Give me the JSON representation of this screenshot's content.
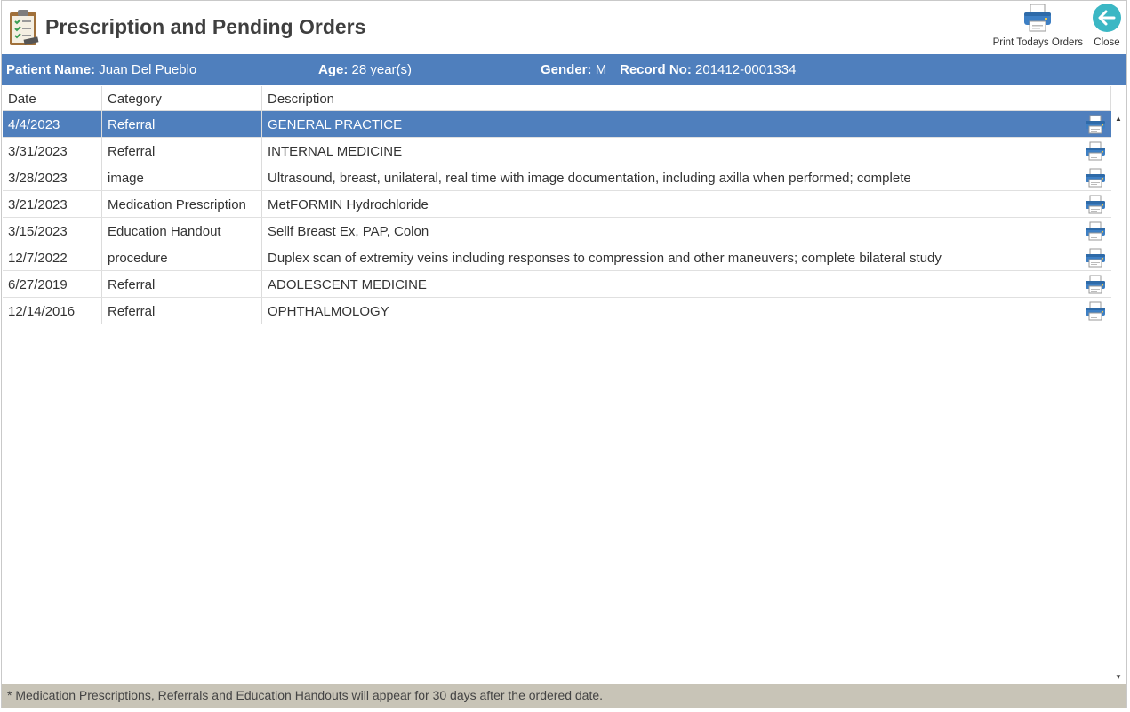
{
  "header": {
    "title": "Prescription and Pending Orders",
    "print_label": "Print Todays Orders",
    "close_label": "Close"
  },
  "patient": {
    "name_label": "Patient Name:",
    "name": "Juan Del Pueblo",
    "age_label": "Age:",
    "age": "28 year(s)",
    "gender_label": "Gender:",
    "gender": "M",
    "record_label": "Record No:",
    "record": "201412-0001334"
  },
  "grid": {
    "columns": [
      "Date",
      "Category",
      "Description"
    ],
    "rows": [
      {
        "date": "4/4/2023",
        "category": "Referral",
        "description": "GENERAL PRACTICE",
        "selected": true
      },
      {
        "date": "3/31/2023",
        "category": "Referral",
        "description": "INTERNAL MEDICINE"
      },
      {
        "date": "3/28/2023",
        "category": "image",
        "description": "Ultrasound, breast, unilateral, real time with image documentation, including axilla when performed; complete"
      },
      {
        "date": "3/21/2023",
        "category": "Medication Prescription",
        "description": "MetFORMIN Hydrochloride"
      },
      {
        "date": "3/15/2023",
        "category": "Education Handout",
        "description": "Sellf Breast Ex, PAP, Colon"
      },
      {
        "date": "12/7/2022",
        "category": "procedure",
        "description": "Duplex scan of extremity veins including responses to compression and other maneuvers; complete bilateral study"
      },
      {
        "date": "6/27/2019",
        "category": "Referral",
        "description": "ADOLESCENT MEDICINE"
      },
      {
        "date": "12/14/2016",
        "category": "Referral",
        "description": "OPHTHALMOLOGY"
      }
    ]
  },
  "footer": {
    "note": "* Medication Prescriptions, Referrals and Education Handouts will appear for 30 days after the ordered date."
  },
  "icons": {
    "app": "clipboard-checklist-icon",
    "print": "printer-icon",
    "close": "back-arrow-icon"
  },
  "colors": {
    "accent": "#4f7fbd",
    "footer_bg": "#c8c4b7",
    "close_circle": "#3bb7c4"
  }
}
